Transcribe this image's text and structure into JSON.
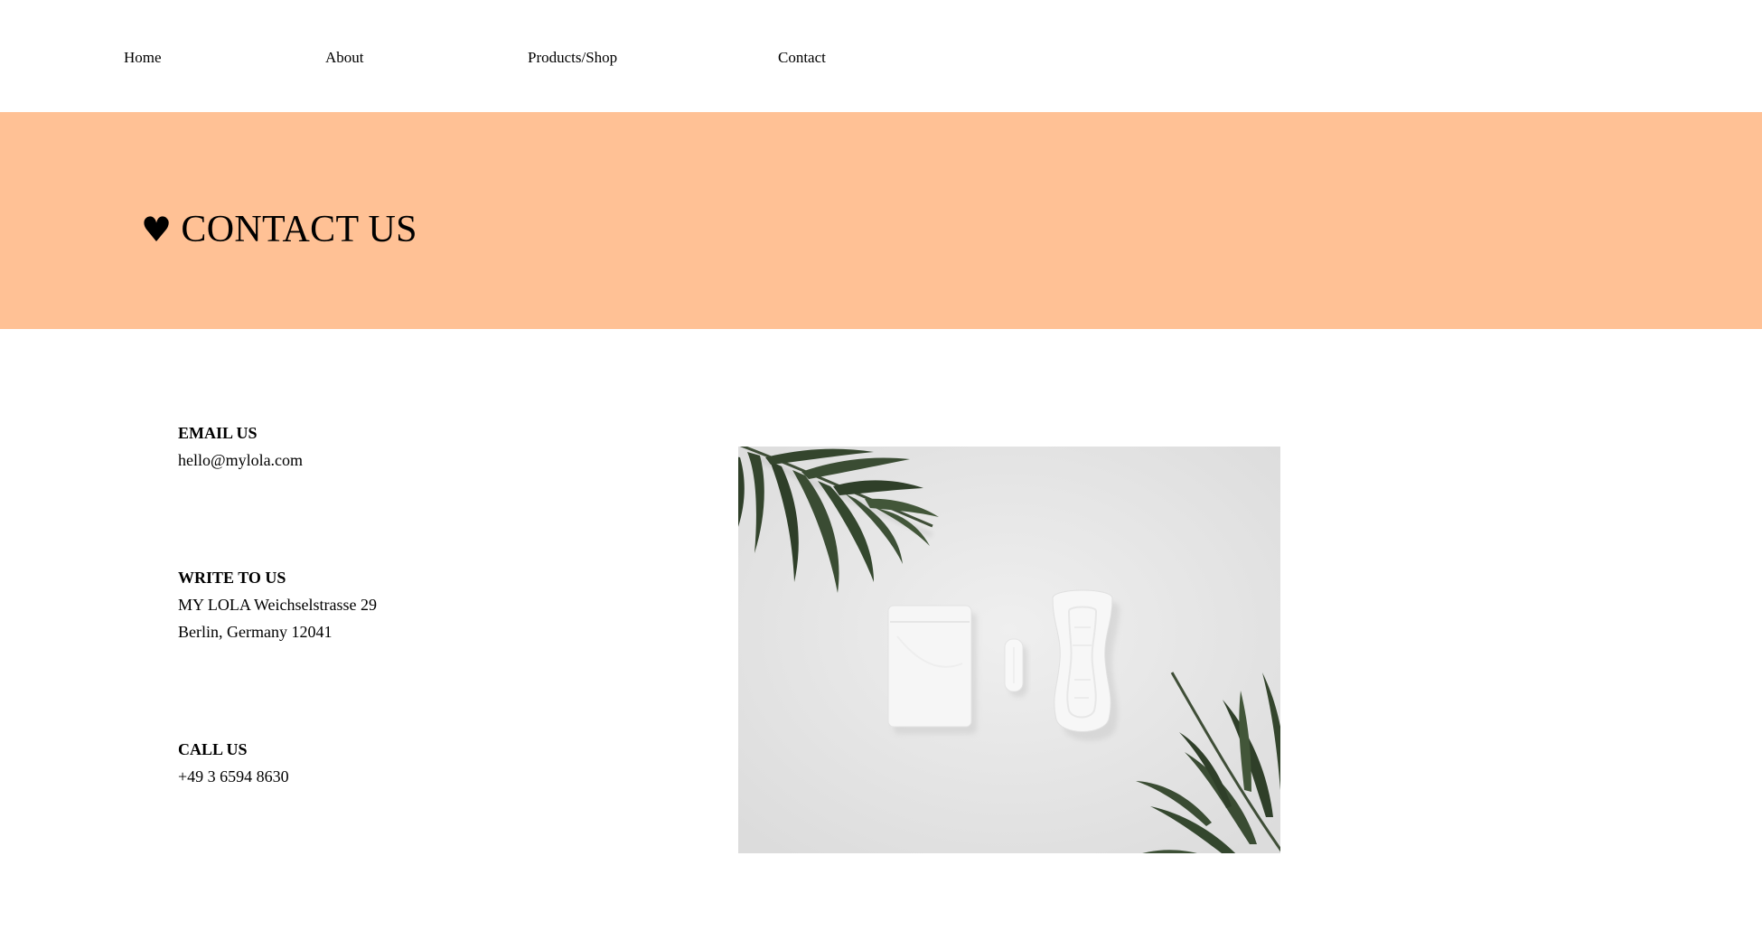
{
  "nav": {
    "items": [
      {
        "label": "Home"
      },
      {
        "label": "About"
      },
      {
        "label": "Products/Shop"
      },
      {
        "label": "Contact"
      }
    ]
  },
  "hero": {
    "heart": "♥",
    "title": "CONTACT US",
    "background": "#ffc195"
  },
  "contact": {
    "email": {
      "label": "EMAIL US",
      "value": "hello@mylola.com"
    },
    "write": {
      "label": "WRITE TO US",
      "line1": "MY LOLA Weichselstrasse 29",
      "line2": "Berlin, Germany 12041"
    },
    "call": {
      "label": "CALL US",
      "value": "+49 3 6594 8630"
    }
  },
  "image": {
    "icon": "product-photo-pads-tampon-leaves"
  }
}
